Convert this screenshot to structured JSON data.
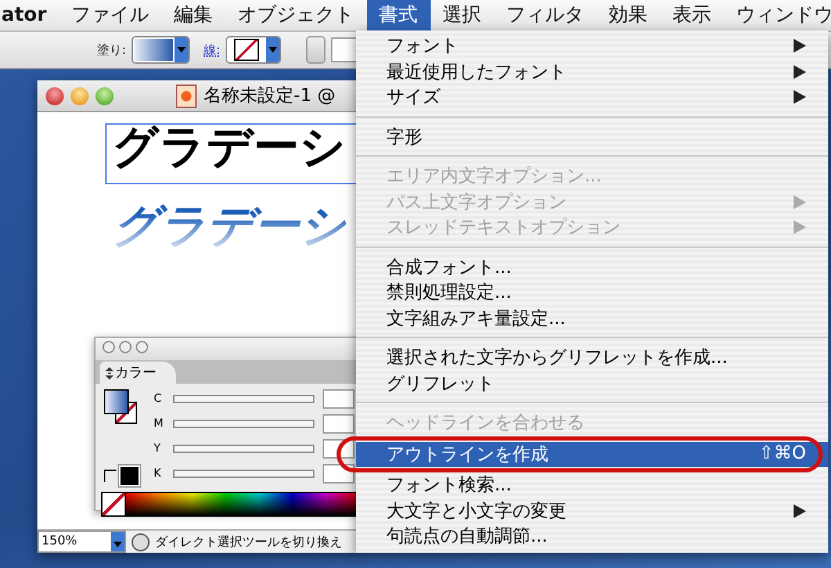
{
  "menu_bar": [
    {
      "label": "ator",
      "selected": false,
      "kind": "app"
    },
    {
      "label": "ファイル",
      "selected": false,
      "kind": "menu"
    },
    {
      "label": "編集",
      "selected": false,
      "kind": "menu"
    },
    {
      "label": "オブジェクト",
      "selected": false,
      "kind": "menu"
    },
    {
      "label": "書式",
      "selected": true,
      "kind": "menu"
    },
    {
      "label": "選択",
      "selected": false,
      "kind": "menu"
    },
    {
      "label": "フィルタ",
      "selected": false,
      "kind": "menu"
    },
    {
      "label": "効果",
      "selected": false,
      "kind": "menu"
    },
    {
      "label": "表示",
      "selected": false,
      "kind": "menu"
    },
    {
      "label": "ウィンドウ",
      "selected": false,
      "kind": "menu"
    }
  ],
  "toolbar": {
    "fill_label": "塗り:",
    "stroke_label": "線:"
  },
  "document": {
    "title": "名称未設定-1 @",
    "art_text": "グラデーシ",
    "gradient_text": "グラデーシ",
    "zoom": "150%",
    "status": "ダイレクト選択ツールを切り換え"
  },
  "color_panel": {
    "tab": "カラー",
    "channels": [
      {
        "name": "C"
      },
      {
        "name": "M"
      },
      {
        "name": "Y"
      },
      {
        "name": "K"
      }
    ]
  },
  "menu": {
    "items": [
      {
        "kind": "item",
        "label": "フォント",
        "submenu": true,
        "disabled": false,
        "selected": false
      },
      {
        "kind": "item",
        "label": "最近使用したフォント",
        "submenu": true,
        "disabled": false,
        "selected": false
      },
      {
        "kind": "item",
        "label": "サイズ",
        "submenu": true,
        "disabled": false,
        "selected": false
      },
      {
        "kind": "separator"
      },
      {
        "kind": "item",
        "label": "字形",
        "submenu": false,
        "disabled": false,
        "selected": false
      },
      {
        "kind": "separator"
      },
      {
        "kind": "item",
        "label": "エリア内文字オプション...",
        "submenu": false,
        "disabled": true,
        "selected": false
      },
      {
        "kind": "item",
        "label": "パス上文字オプション",
        "submenu": true,
        "disabled": true,
        "selected": false
      },
      {
        "kind": "item",
        "label": "スレッドテキストオプション",
        "submenu": true,
        "disabled": true,
        "selected": false
      },
      {
        "kind": "separator"
      },
      {
        "kind": "item",
        "label": "合成フォント...",
        "submenu": false,
        "disabled": false,
        "selected": false
      },
      {
        "kind": "item",
        "label": "禁則処理設定...",
        "submenu": false,
        "disabled": false,
        "selected": false
      },
      {
        "kind": "item",
        "label": "文字組みアキ量設定...",
        "submenu": false,
        "disabled": false,
        "selected": false
      },
      {
        "kind": "separator"
      },
      {
        "kind": "item",
        "label": "選択された文字からグリフレットを作成...",
        "submenu": false,
        "disabled": false,
        "selected": false
      },
      {
        "kind": "item",
        "label": "グリフレット",
        "submenu": false,
        "disabled": false,
        "selected": false
      },
      {
        "kind": "separator"
      },
      {
        "kind": "item",
        "label": "ヘッドラインを合わせる",
        "submenu": false,
        "disabled": true,
        "selected": false
      },
      {
        "kind": "item",
        "label": "アウトラインを作成",
        "shortcut": "⇧⌘O",
        "submenu": false,
        "disabled": false,
        "selected": true,
        "circled": true
      },
      {
        "kind": "item",
        "label": "フォント検索...",
        "submenu": false,
        "disabled": false,
        "selected": false
      },
      {
        "kind": "item",
        "label": "大文字と小文字の変更",
        "submenu": true,
        "disabled": false,
        "selected": false
      },
      {
        "kind": "item",
        "label": "句読点の自動調節...",
        "submenu": false,
        "disabled": false,
        "selected": false
      }
    ]
  }
}
